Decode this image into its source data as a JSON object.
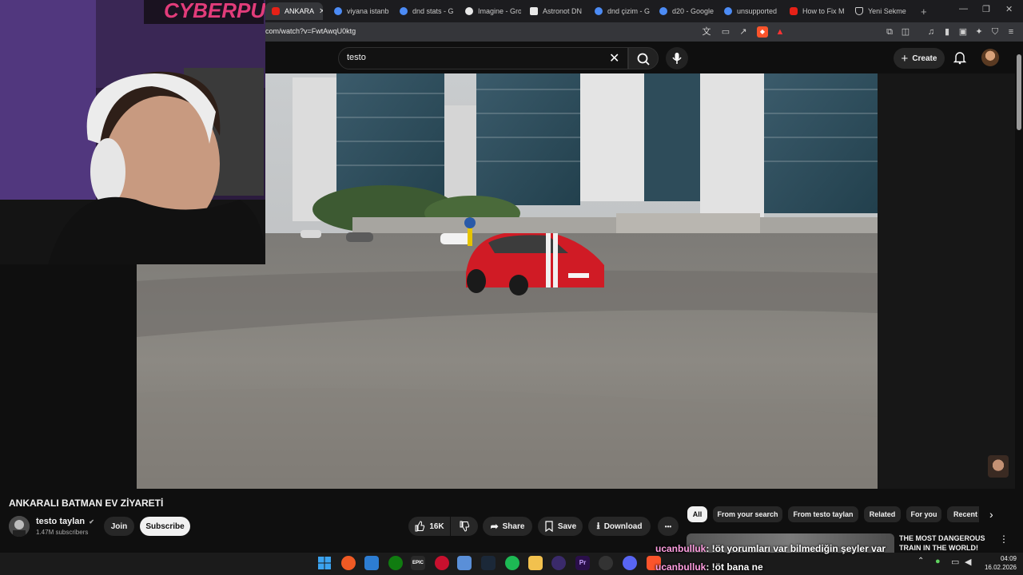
{
  "browser": {
    "tabs": [
      {
        "label": "ANKARA",
        "color": "#e62117",
        "active": true
      },
      {
        "label": "viyana istanb",
        "color": "#4c8bf5"
      },
      {
        "label": "dnd stats - G",
        "color": "#4c8bf5"
      },
      {
        "label": "Imagine - Gro",
        "color": "#e8e8e8"
      },
      {
        "label": "Astronot DN",
        "color": "#e8e8e8"
      },
      {
        "label": "dnd çizim - G",
        "color": "#4c8bf5"
      },
      {
        "label": "d20 - Google",
        "color": "#4c8bf5"
      },
      {
        "label": "unsupported",
        "color": "#4c8bf5"
      },
      {
        "label": "How to Fix M",
        "color": "#e62117"
      },
      {
        "label": "Yeni Sekme",
        "color": "#cfcfcf"
      }
    ],
    "new_tab": "+",
    "url": "com/watch?v=FwtAwqU0ktg"
  },
  "youtube": {
    "search_value": "testo",
    "create_label": "Create",
    "video_title": "ANKARALI BATMAN EV ZİYARETİ",
    "channel": {
      "name": "testo taylan",
      "subscribers": "1.47M subscribers"
    },
    "join_label": "Join",
    "subscribe_label": "Subscribe",
    "like_count": "16K",
    "share_label": "Share",
    "save_label": "Save",
    "download_label": "Download",
    "more_label": "•••",
    "chips": [
      "All",
      "From your search",
      "From testo taylan",
      "Related",
      "For you",
      "Recent"
    ],
    "recommended": {
      "title": "THE MOST DANGEROUS TRAIN IN THE WORLD!"
    }
  },
  "chat": [
    {
      "user": "ucanbulluk",
      "message": ": !öt yorumları var bilmediğin şeyler var"
    },
    {
      "user": "ucanbulluk",
      "message": ": !öt bana ne"
    }
  ],
  "taskbar": {
    "time": "04:09",
    "date": "16.02.2026"
  },
  "colors": {
    "youtube_bg": "#0f0f0f",
    "accent_red": "#e62117",
    "car_red": "#d01b25"
  }
}
